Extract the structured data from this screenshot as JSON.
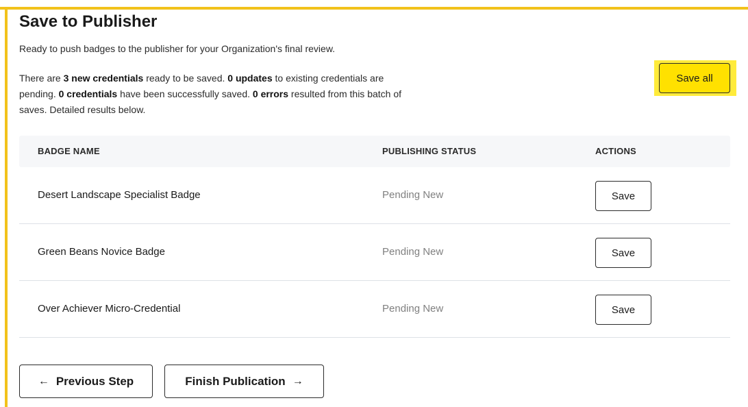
{
  "page": {
    "title": "Save to Publisher",
    "intro": "Ready to push badges to the publisher for your Organization's final review."
  },
  "summary": {
    "t1": "There are ",
    "new_count": "3 new credentials",
    "t2": " ready to be saved. ",
    "updates_count": "0 updates",
    "t3": " to existing credentials are pending. ",
    "saved_count": "0 credentials",
    "t4": " have been successfully saved. ",
    "errors_count": "0 errors",
    "t5": " resulted from this batch of saves. Detailed results below."
  },
  "actions": {
    "save_all_label": "Save all"
  },
  "table": {
    "headers": {
      "badge_name": "BADGE NAME",
      "publishing_status": "PUBLISHING STATUS",
      "actions": "ACTIONS"
    },
    "rows": [
      {
        "name": "Desert Landscape Specialist Badge",
        "status": "Pending New",
        "action": "Save"
      },
      {
        "name": "Green Beans Novice Badge",
        "status": "Pending New",
        "action": "Save"
      },
      {
        "name": "Over Achiever Micro-Credential",
        "status": "Pending New",
        "action": "Save"
      }
    ]
  },
  "nav": {
    "previous_arrow": "←",
    "previous_label": "Previous Step",
    "finish_label": "Finish Publication",
    "finish_arrow": "→"
  },
  "colors": {
    "accent_frame": "#f2c21b",
    "highlight": "#ffeb3b",
    "primary_button": "#ffe100"
  }
}
